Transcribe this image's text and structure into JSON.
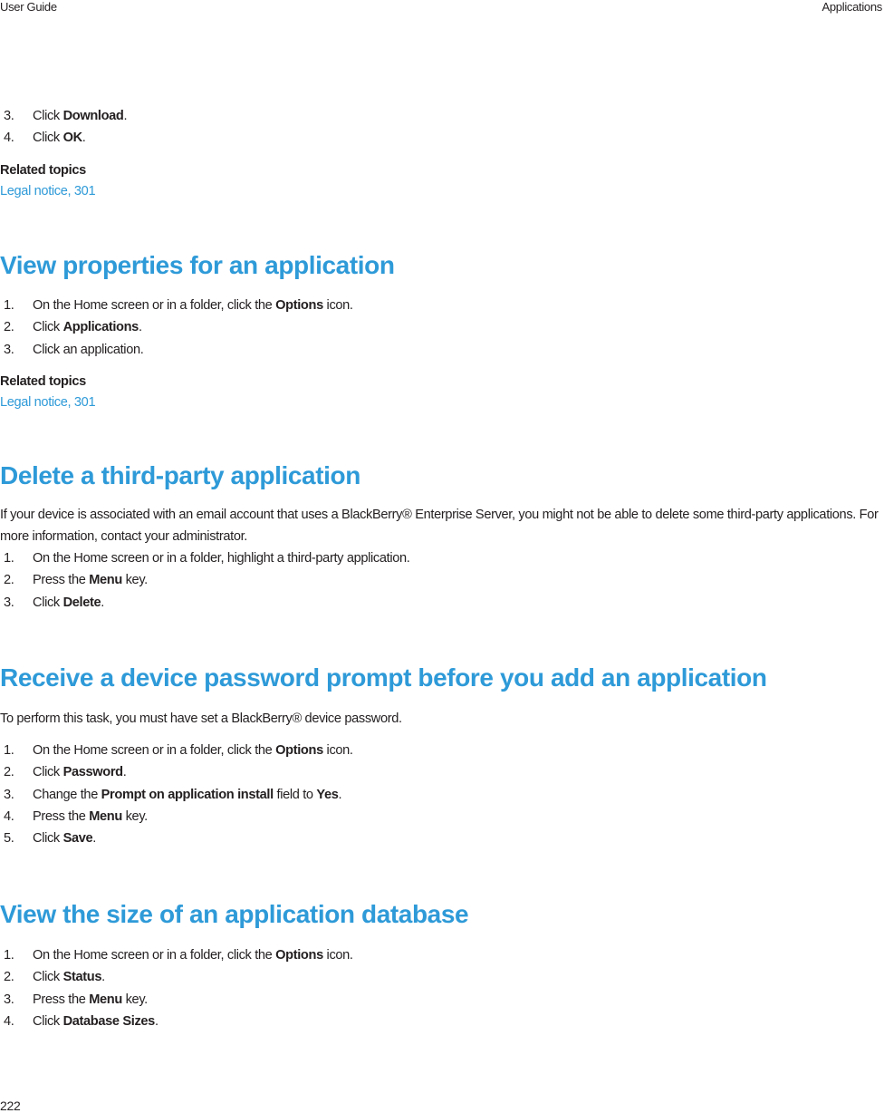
{
  "header": {
    "left": "User Guide",
    "right": "Applications"
  },
  "footer": {
    "page_number": "222"
  },
  "top_fragment": {
    "steps": [
      {
        "num": "3.",
        "pre": "Click ",
        "bold": "Download",
        "post": "."
      },
      {
        "num": "4.",
        "pre": "Click ",
        "bold": "OK",
        "post": "."
      }
    ],
    "related_heading": "Related topics",
    "related_link": "Legal notice, 301"
  },
  "sections": [
    {
      "title": "View properties for an application",
      "steps": [
        {
          "num": "1.",
          "pre": "On the Home screen or in a folder, click the ",
          "bold": "Options",
          "post": " icon."
        },
        {
          "num": "2.",
          "pre": "Click ",
          "bold": "Applications",
          "post": "."
        },
        {
          "num": "3.",
          "pre": "Click an application.",
          "bold": "",
          "post": ""
        }
      ],
      "related_heading": "Related topics",
      "related_link": "Legal notice, 301"
    },
    {
      "title": "Delete a third-party application",
      "intro": "If your device is associated with an email account that uses a BlackBerry® Enterprise Server, you might not be able to delete some third-party applications. For more information, contact your administrator.",
      "steps": [
        {
          "num": "1.",
          "pre": "On the Home screen or in a folder, highlight a third-party application.",
          "bold": "",
          "post": ""
        },
        {
          "num": "2.",
          "pre": "Press the ",
          "bold": "Menu",
          "post": " key."
        },
        {
          "num": "3.",
          "pre": "Click ",
          "bold": "Delete",
          "post": "."
        }
      ]
    },
    {
      "title": "Receive a device password prompt before you add an application",
      "intro": "To perform this task, you must have set a BlackBerry® device password.",
      "steps": [
        {
          "num": "1.",
          "pre": "On the Home screen or in a folder, click the ",
          "bold": "Options",
          "post": " icon."
        },
        {
          "num": "2.",
          "pre": "Click ",
          "bold": "Password",
          "post": "."
        },
        {
          "num": "3.",
          "pre": "Change the ",
          "bold": "Prompt on application install",
          "post": " field to ",
          "bold2": "Yes",
          "post2": "."
        },
        {
          "num": "4.",
          "pre": "Press the ",
          "bold": "Menu",
          "post": " key."
        },
        {
          "num": "5.",
          "pre": "Click ",
          "bold": "Save",
          "post": "."
        }
      ]
    },
    {
      "title": "View the size of an application database",
      "steps": [
        {
          "num": "1.",
          "pre": "On the Home screen or in a folder, click the ",
          "bold": "Options",
          "post": " icon."
        },
        {
          "num": "2.",
          "pre": "Click ",
          "bold": "Status",
          "post": "."
        },
        {
          "num": "3.",
          "pre": "Press the ",
          "bold": "Menu",
          "post": " key."
        },
        {
          "num": "4.",
          "pre": "Click ",
          "bold": "Database Sizes",
          "post": "."
        }
      ]
    }
  ],
  "colors": {
    "heading": "#2e9ad8",
    "link": "#2e9ad8",
    "text": "#231f20"
  }
}
